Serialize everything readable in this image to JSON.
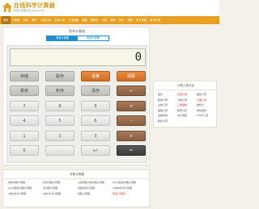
{
  "header": {
    "site_title": "在线科学计算器",
    "site_subtitle": "科学计算器大全 jisuanqi.la"
  },
  "nav": {
    "items": [
      "首页",
      "计算器",
      "科学",
      "数学",
      "平面几何",
      "立体几何",
      "三角函数",
      "函数",
      "微积分",
      "分数",
      "概率",
      "统计",
      "转换",
      "电子电路",
      "房贷计算"
    ]
  },
  "calculator": {
    "title": "简单计算器",
    "tabs": [
      "简单计算器",
      "普通计算器"
    ],
    "display_value": "0",
    "rows": [
      [
        "存储",
        "取存",
        "退格",
        "清屏"
      ],
      [
        "累存",
        "积存",
        "清存",
        "÷"
      ],
      [
        "7",
        "8",
        "9",
        "×"
      ],
      [
        "4",
        "5",
        "6",
        "-"
      ],
      [
        "1",
        "2",
        "3",
        "+"
      ],
      [
        "0",
        ".",
        "+/-",
        "="
      ]
    ]
  },
  "sidebar": {
    "title": "计算工具大全",
    "links": [
      {
        "text": "首页",
        "hot": false
      },
      {
        "text": "无限计算",
        "hot": true
      },
      {
        "text": "图形计算",
        "hot": false
      },
      {
        "text": "数学计算",
        "hot": false
      },
      {
        "text": "分数计算",
        "hot": false
      },
      {
        "text": "平面几何",
        "hot": true
      },
      {
        "text": "立体几何",
        "hot": false
      },
      {
        "text": "三角函数",
        "hot": true
      },
      {
        "text": "微积分",
        "hot": false
      },
      {
        "text": "函数计算",
        "hot": false
      },
      {
        "text": "概率计算",
        "hot": false
      },
      {
        "text": "单位转换",
        "hot": false
      },
      {
        "text": "进制转换",
        "hot": false
      },
      {
        "text": "电子电路",
        "hot": false
      },
      {
        "text": "HTML工具",
        "hot": false
      },
      {
        "text": "随机计算",
        "hot": false
      }
    ]
  },
  "bottom": {
    "title": "对数计算器",
    "links": [
      {
        "text": "常用对数计算器",
        "more": false
      },
      {
        "text": "自然对数计算器",
        "more": false
      },
      {
        "text": "以任意数为底对数计算器",
        "more": false
      },
      {
        "text": "以2为底的对数计算器",
        "more": false
      },
      {
        "text": "以e为底的对数计算器",
        "more": false
      },
      {
        "text": "反对数计算器",
        "more": false
      },
      {
        "text": "对数运算计算器",
        "more": false
      },
      {
        "text": "10的N次方计算器",
        "more": false
      },
      {
        "text": "2的N次方计算器",
        "more": false
      },
      {
        "text": "e的N次方计算器",
        "more": false
      },
      {
        "text": "指数计算器",
        "more": false
      },
      {
        "text": "更多计算器...",
        "more": true
      }
    ]
  },
  "colors": {
    "nav": "#e8a020",
    "accent_blue": "#1b8fcf",
    "orange_button": "#e88a40",
    "hot_link": "#dd3333"
  }
}
